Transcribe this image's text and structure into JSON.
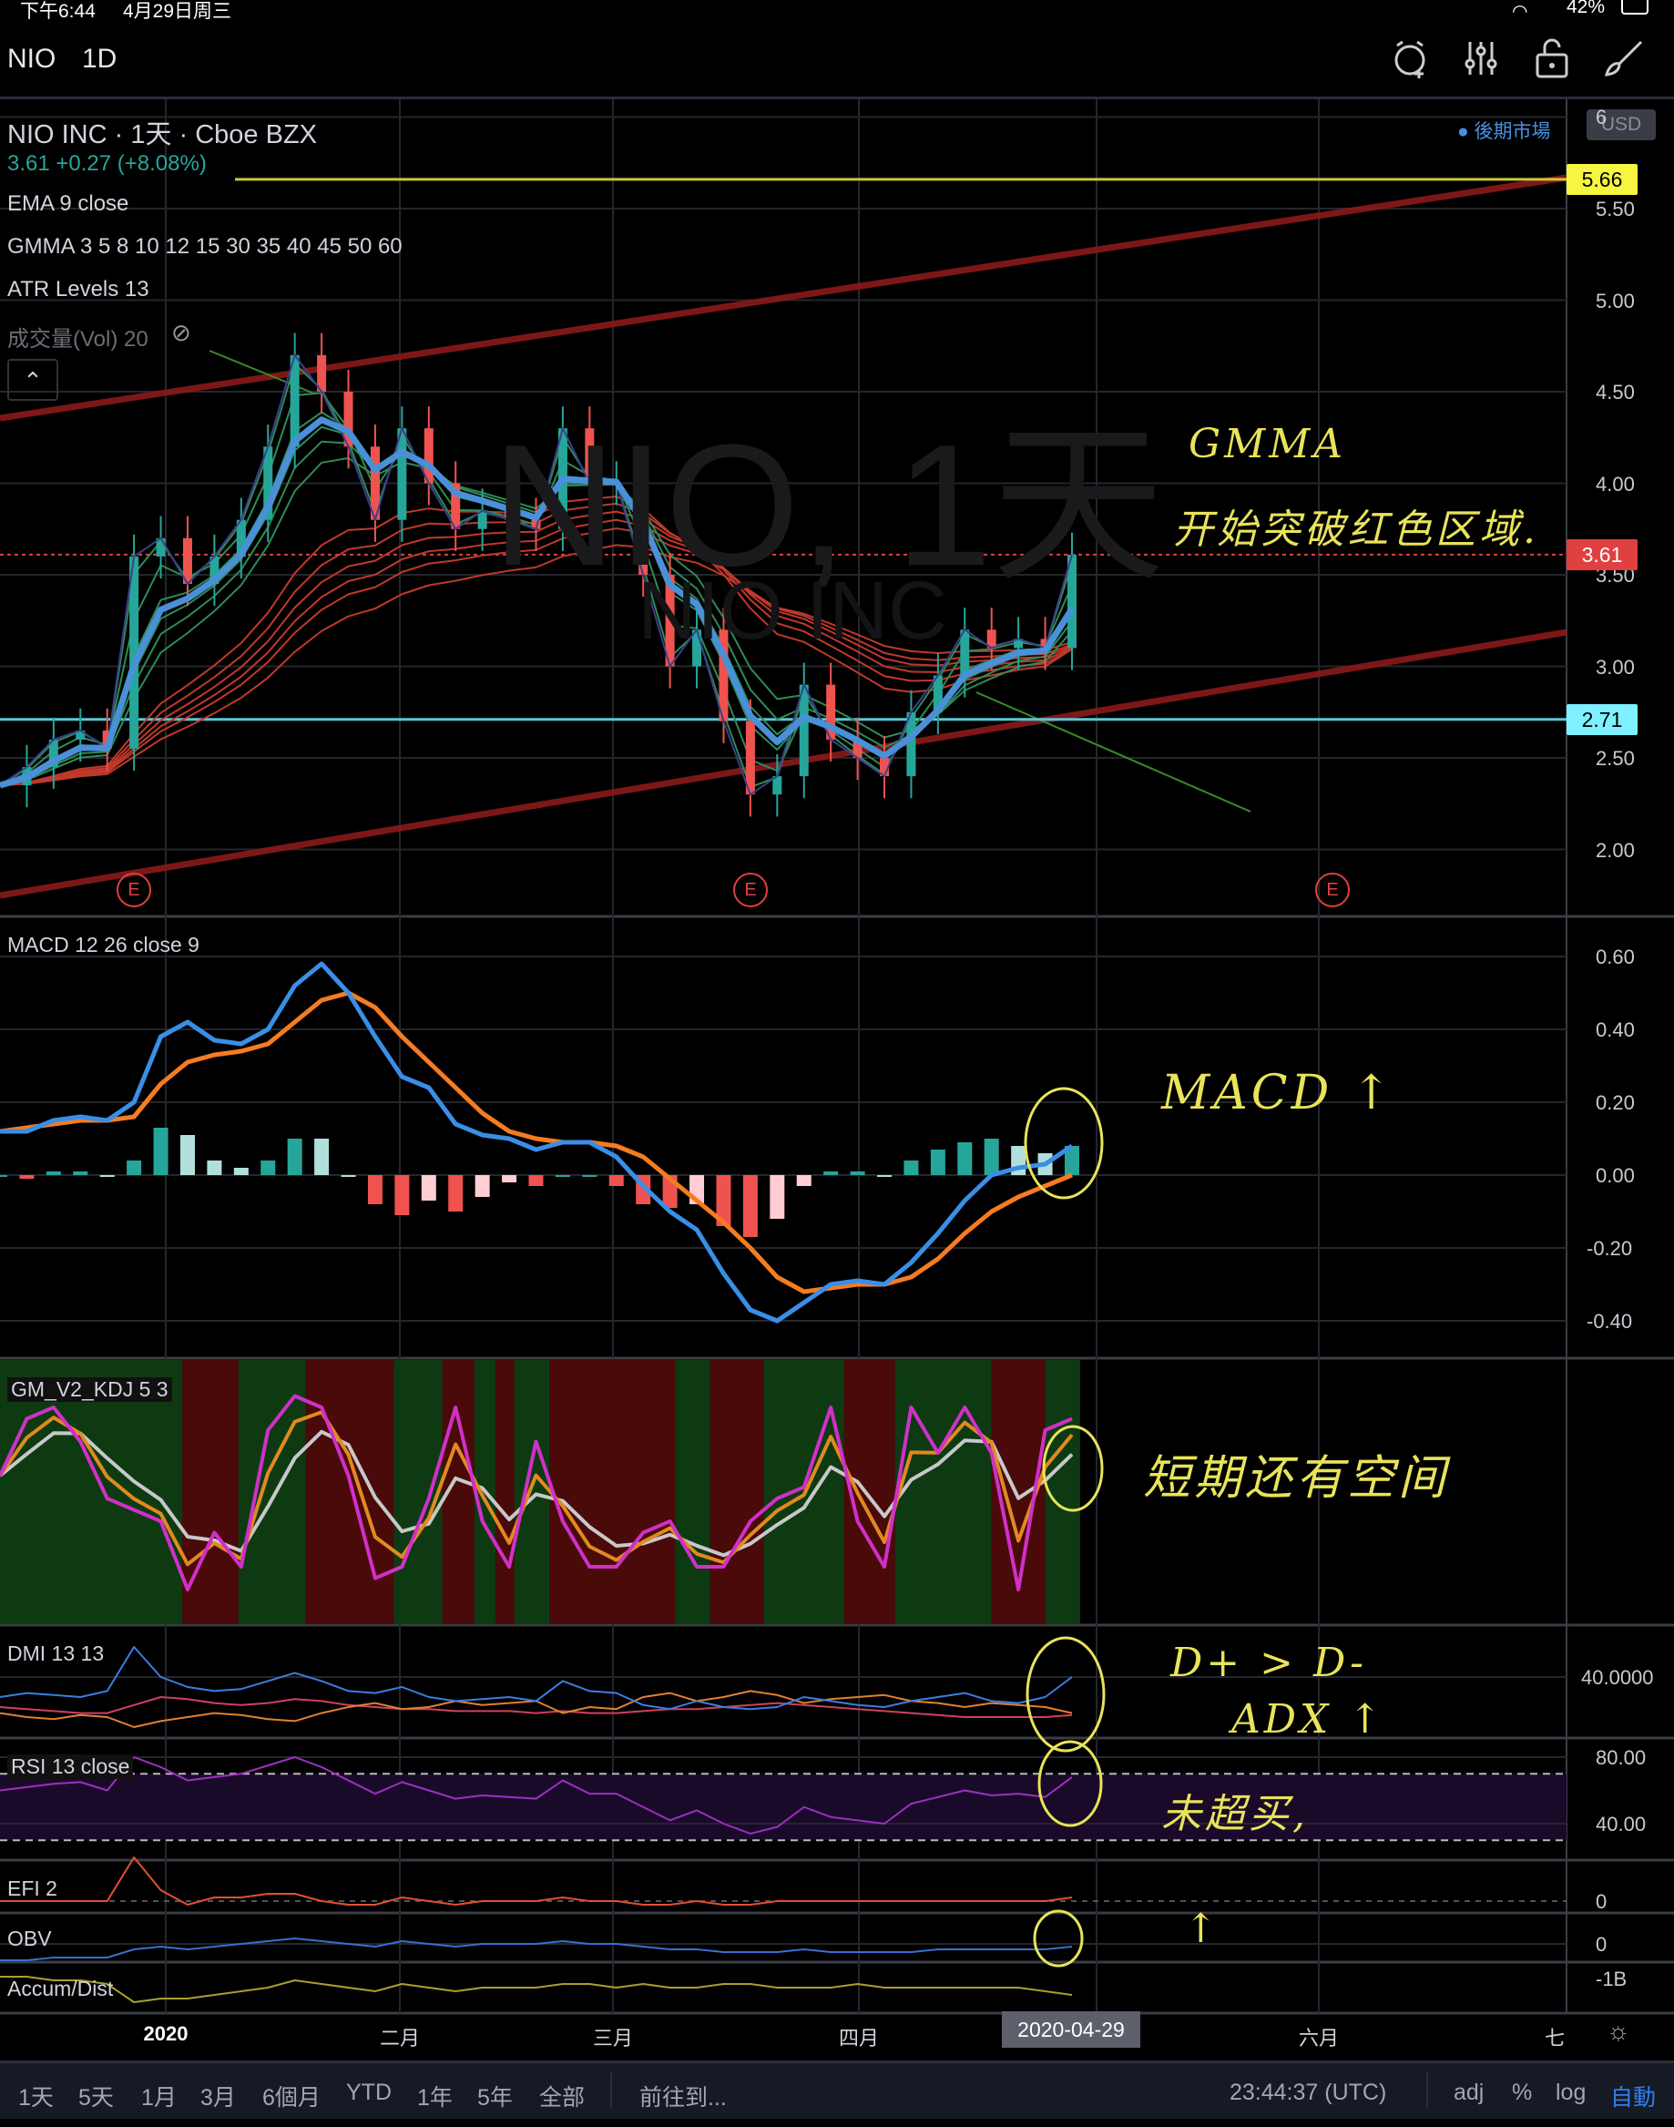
{
  "status_bar": {
    "time": "下午6:44",
    "date": "4月29日周三",
    "battery": "42%"
  },
  "header": {
    "symbol": "NIO",
    "interval": "1D",
    "icons": [
      "alarm-plus-icon",
      "indicators-sliders-icon",
      "lock-open-icon",
      "brush-icon"
    ]
  },
  "legend": {
    "title": "NIO INC · 1天 · Cboe BZX",
    "quote": "3.61 +0.27 (+8.08%)",
    "indicators": [
      "EMA 9 close",
      "GMMA 3 5 8 10 12 15 30 35 40 45 50 60",
      "ATR Levels 13",
      "成交量(Vol) 20"
    ],
    "after_hours": "● 後期市場",
    "currency": "USD"
  },
  "watermark": {
    "big": "NIO, 1天",
    "small": "NIO INC"
  },
  "price_axis": {
    "labels": [
      "6",
      "5.50",
      "5.00",
      "4.50",
      "4.00",
      "3.50",
      "3.00",
      "2.50",
      "2.00"
    ],
    "ticks": [
      5.5,
      5.0,
      4.5,
      4.0,
      3.5,
      3.0,
      2.5,
      2.0
    ]
  },
  "price_badges": {
    "resistance": "5.66",
    "last": "3.61",
    "support": "2.71"
  },
  "levels": {
    "resistance": 5.66,
    "last": 3.61,
    "support": 2.71
  },
  "colors": {
    "up": "#26a69a",
    "down": "#ef5350",
    "ema": "#4a90d9",
    "gmma_short": "#2e8b57",
    "gmma_long": "#c0392b",
    "resistance": "#c8c83c",
    "support": "#56c8d8",
    "channel": "#8b1a1a",
    "annotation": "#e8e35a"
  },
  "earnings_marker": "E",
  "chart_data": [
    {
      "type": "line",
      "title": "NIO 1D price (close, sampled)",
      "x_range": [
        "2019-12",
        "2020-04-29"
      ],
      "ylim": [
        1.8,
        6.0
      ],
      "close": [
        2.35,
        2.45,
        2.6,
        2.65,
        2.55,
        3.6,
        3.7,
        3.45,
        3.6,
        3.8,
        4.2,
        4.7,
        4.5,
        4.2,
        3.8,
        4.3,
        4.0,
        3.75,
        3.85,
        3.8,
        3.75,
        4.3,
        4.0,
        4.0,
        3.5,
        3.0,
        3.2,
        2.7,
        2.3,
        2.4,
        2.9,
        2.6,
        2.5,
        2.4,
        2.75,
        2.95,
        3.2,
        3.1,
        3.15,
        3.1,
        3.61
      ]
    },
    {
      "type": "line",
      "title": "MACD 12 26 close 9",
      "ylim": [
        -0.45,
        0.65
      ],
      "ticks": [
        "0.60",
        "0.40",
        "0.20",
        "0.00",
        "-0.20",
        "-0.40"
      ],
      "macd": [
        0.12,
        0.12,
        0.15,
        0.16,
        0.15,
        0.2,
        0.38,
        0.42,
        0.37,
        0.36,
        0.4,
        0.52,
        0.58,
        0.5,
        0.38,
        0.27,
        0.24,
        0.14,
        0.11,
        0.1,
        0.07,
        0.09,
        0.09,
        0.05,
        -0.03,
        -0.1,
        -0.15,
        -0.27,
        -0.37,
        -0.4,
        -0.35,
        -0.3,
        -0.29,
        -0.3,
        -0.24,
        -0.16,
        -0.07,
        0.0,
        0.02,
        0.03,
        0.08
      ],
      "signal": [
        0.12,
        0.13,
        0.14,
        0.15,
        0.15,
        0.16,
        0.25,
        0.31,
        0.33,
        0.34,
        0.36,
        0.42,
        0.48,
        0.5,
        0.46,
        0.38,
        0.31,
        0.24,
        0.17,
        0.12,
        0.1,
        0.09,
        0.09,
        0.08,
        0.05,
        -0.01,
        -0.07,
        -0.13,
        -0.2,
        -0.28,
        -0.32,
        -0.31,
        -0.3,
        -0.3,
        -0.28,
        -0.23,
        -0.16,
        -0.1,
        -0.06,
        -0.03,
        0.0
      ]
    },
    {
      "type": "line",
      "title": "GM_V2_KDJ 5 3",
      "ylim": [
        -10,
        110
      ],
      "j": [
        60,
        85,
        90,
        75,
        50,
        45,
        40,
        10,
        35,
        20,
        80,
        95,
        90,
        60,
        15,
        20,
        50,
        90,
        40,
        20,
        75,
        40,
        20,
        20,
        35,
        40,
        20,
        20,
        40,
        50,
        55,
        90,
        40,
        20,
        90,
        70,
        90,
        70,
        10,
        80,
        85
      ],
      "zones": [
        [
          0,
          6.8,
          "green"
        ],
        [
          6.8,
          8.9,
          "red"
        ],
        [
          8.9,
          11.4,
          "green"
        ],
        [
          11.4,
          14.7,
          "red"
        ],
        [
          14.7,
          16.5,
          "green"
        ],
        [
          16.5,
          17.7,
          "red"
        ],
        [
          17.7,
          18.5,
          "green"
        ],
        [
          18.5,
          19.2,
          "red"
        ],
        [
          19.2,
          20.5,
          "green"
        ],
        [
          20.5,
          25.2,
          "red"
        ],
        [
          25.2,
          26.5,
          "green"
        ],
        [
          26.5,
          28.5,
          "red"
        ],
        [
          28.5,
          31.5,
          "green"
        ],
        [
          31.5,
          33.4,
          "red"
        ],
        [
          33.4,
          37,
          "green"
        ],
        [
          37,
          39,
          "red"
        ],
        [
          39,
          40.3,
          "green"
        ]
      ]
    },
    {
      "type": "line",
      "title": "DMI 13 13",
      "ylim": [
        0,
        60
      ],
      "ticks": [
        "40.0000"
      ],
      "dplus": [
        30,
        32,
        31,
        30,
        33,
        55,
        40,
        35,
        33,
        34,
        38,
        42,
        38,
        33,
        32,
        35,
        30,
        28,
        29,
        30,
        28,
        38,
        33,
        32,
        26,
        24,
        28,
        25,
        24,
        25,
        30,
        28,
        26,
        25,
        28,
        30,
        32,
        28,
        27,
        30,
        40
      ],
      "dminus": [
        22,
        20,
        19,
        21,
        20,
        15,
        18,
        20,
        22,
        21,
        19,
        18,
        22,
        25,
        27,
        24,
        25,
        28,
        26,
        27,
        28,
        22,
        25,
        24,
        30,
        32,
        28,
        30,
        33,
        31,
        27,
        29,
        30,
        31,
        28,
        27,
        25,
        27,
        26,
        25,
        22
      ],
      "adx": [
        25,
        24,
        23,
        22,
        22,
        26,
        30,
        29,
        27,
        26,
        27,
        29,
        28,
        26,
        25,
        24,
        24,
        23,
        23,
        23,
        22,
        23,
        22,
        22,
        23,
        24,
        24,
        25,
        26,
        27,
        26,
        25,
        24,
        23,
        22,
        21,
        20,
        20,
        20,
        20,
        21
      ]
    },
    {
      "type": "line",
      "title": "RSI 13 close",
      "ylim": [
        20,
        85
      ],
      "ticks": [
        "80.00",
        "40.00"
      ],
      "bands": [
        30,
        70
      ],
      "rsi": [
        60,
        62,
        64,
        65,
        60,
        80,
        74,
        66,
        68,
        70,
        75,
        80,
        74,
        66,
        58,
        65,
        60,
        55,
        57,
        56,
        55,
        66,
        58,
        58,
        50,
        42,
        48,
        40,
        34,
        38,
        50,
        44,
        42,
        40,
        52,
        56,
        60,
        57,
        58,
        56,
        68
      ]
    },
    {
      "type": "line",
      "title": "EFI 2",
      "ticks": [
        "0"
      ],
      "efi": [
        0,
        0,
        0,
        0,
        0,
        12,
        3,
        -1,
        1,
        1,
        2,
        2,
        0,
        -1,
        -1,
        1,
        0,
        -1,
        0,
        0,
        0,
        1,
        0,
        0,
        -1,
        -1,
        0,
        -1,
        -1,
        0,
        0,
        0,
        0,
        0,
        0,
        0,
        0,
        0,
        0,
        0,
        1
      ]
    },
    {
      "type": "line",
      "title": "OBV",
      "ticks": [
        "0"
      ],
      "obv": [
        -6,
        -6,
        -5,
        -5,
        -5,
        -2,
        -1,
        -2,
        -1,
        0,
        1,
        2,
        1,
        0,
        -1,
        1,
        0,
        -1,
        0,
        0,
        0,
        1,
        0,
        0,
        -1,
        -2,
        -2,
        -3,
        -3,
        -3,
        -2,
        -3,
        -3,
        -3,
        -3,
        -2,
        -2,
        -2,
        -2,
        -2,
        -1
      ]
    },
    {
      "type": "line",
      "title": "Accum/Dist",
      "ticks": [
        "-1B"
      ],
      "ad": [
        3,
        3,
        2,
        2,
        1,
        -4,
        -3,
        -3,
        -2,
        -1,
        0,
        2,
        1,
        0,
        -1,
        1,
        0,
        -1,
        0,
        0,
        0,
        1,
        1,
        0,
        1,
        0,
        0,
        1,
        1,
        0,
        0,
        0,
        1,
        0,
        0,
        0,
        0,
        0,
        0,
        -1,
        -2
      ]
    }
  ],
  "time_axis": {
    "labels": [
      "2020",
      "二月",
      "三月",
      "四月",
      "六月",
      "七"
    ],
    "cursor_date": "2020-04-29"
  },
  "annotations": {
    "gmma_title": "GMMA",
    "gmma_note": "开始突破红色区域.",
    "macd_note": "MACD ↑",
    "kdj_note": "短期还有空间",
    "dmi_note1": "D+ > D-",
    "dmi_note2": "ADX ↑",
    "rsi_note": "未超买,",
    "obv_note": "↑"
  },
  "bottom_bar": {
    "ranges": [
      "1天",
      "5天",
      "1月",
      "3月",
      "6個月",
      "YTD",
      "1年",
      "5年",
      "全部"
    ],
    "goto": "前往到...",
    "clock": "23:44:37 (UTC)",
    "options": [
      "adj",
      "%",
      "log",
      "自動"
    ]
  }
}
